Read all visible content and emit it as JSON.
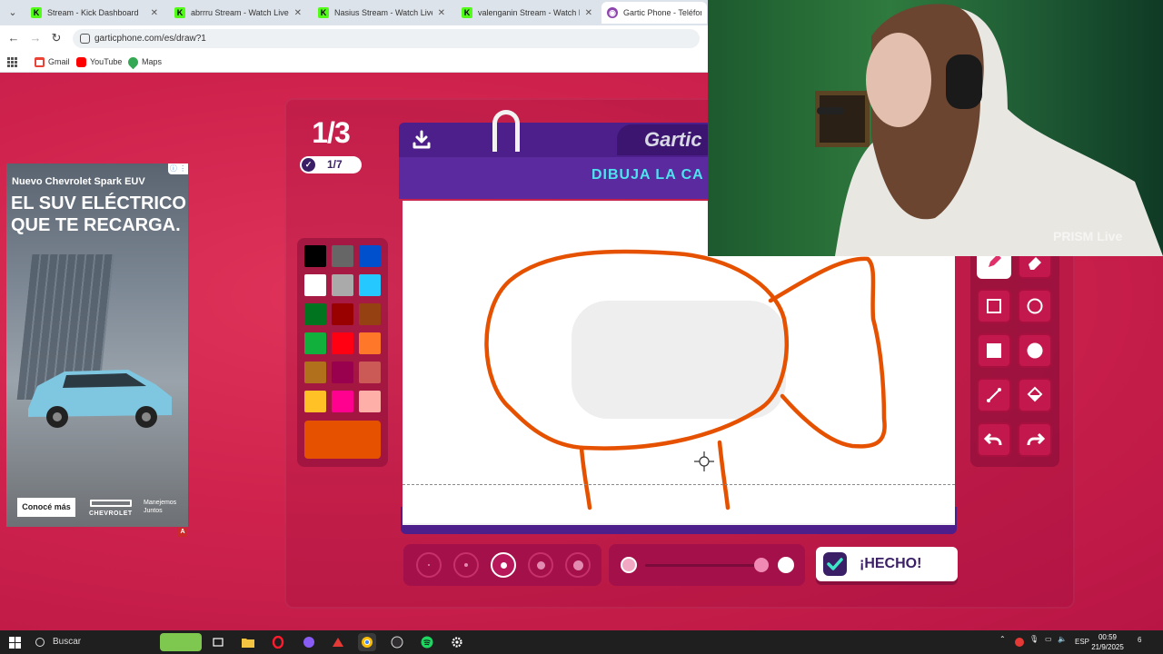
{
  "browser": {
    "tabs": [
      {
        "label": "Stream - Kick Dashboard",
        "favicon": "kick-icon",
        "active": false
      },
      {
        "label": "abrrru Stream - Watch Live on Kick",
        "favicon": "kick-icon",
        "active": false
      },
      {
        "label": "Nasius Stream - Watch Live on Kick",
        "favicon": "kick-icon",
        "active": false
      },
      {
        "label": "valenganin Stream - Watch Live",
        "favicon": "kick-icon",
        "active": false
      },
      {
        "label": "Gartic Phone - Teléfono De",
        "favicon": "gartic-icon",
        "active": true
      }
    ],
    "close_glyph": "✕",
    "url": "garticphone.com/es/draw?1",
    "bookmarks": [
      {
        "label": "Gmail",
        "icon": "gmail-icon",
        "color": "#ea4335"
      },
      {
        "label": "YouTube",
        "icon": "youtube-icon",
        "color": "#ff0000"
      },
      {
        "label": "Maps",
        "icon": "maps-icon",
        "color": "#34a853"
      }
    ]
  },
  "game": {
    "round": "1/3",
    "players_done": "1/7",
    "logo_text": "Gartic",
    "instruction": "DIBUJA LA CA",
    "done_label": "¡HECHO!",
    "palette": [
      "#000000",
      "#666666",
      "#0050cd",
      "#ffffff",
      "#aaaaaa",
      "#26c9ff",
      "#017420",
      "#990000",
      "#964112",
      "#11b03c",
      "#ff0013",
      "#ff7829",
      "#b0701c",
      "#99004e",
      "#cb5a57",
      "#ffc126",
      "#ff008f",
      "#feafa8"
    ],
    "current_color": "#e65100",
    "stroke_color": "#e65100",
    "sizes": [
      {
        "name": "size-1",
        "active": false
      },
      {
        "name": "size-2",
        "active": false
      },
      {
        "name": "size-3",
        "active": true
      },
      {
        "name": "size-4",
        "active": false
      },
      {
        "name": "size-5",
        "active": false
      }
    ],
    "tools": [
      {
        "name": "pen-tool",
        "active": true
      },
      {
        "name": "eraser-tool",
        "active": false
      },
      {
        "name": "rectangle-outline-tool",
        "active": false
      },
      {
        "name": "ellipse-outline-tool",
        "active": false
      },
      {
        "name": "rectangle-fill-tool",
        "active": false
      },
      {
        "name": "ellipse-fill-tool",
        "active": false
      },
      {
        "name": "line-tool",
        "active": false
      },
      {
        "name": "fill-bucket-tool",
        "active": false
      },
      {
        "name": "undo-tool",
        "active": false
      },
      {
        "name": "redo-tool",
        "active": false
      }
    ]
  },
  "ad": {
    "subtitle": "Nuevo Chevrolet Spark EUV",
    "headline": "EL SUV ELÉCTRICO QUE TE RECARGA.",
    "cta": "Conocé más",
    "brand": "CHEVROLET",
    "tagline": "Manejemos Juntos",
    "choice_mark": "A"
  },
  "webcam": {
    "watermark": "PRISM Live"
  },
  "taskbar": {
    "search_placeholder": "Buscar",
    "language": "ESP",
    "time": "00:59",
    "date": "21/9/2025",
    "notifications": "6"
  }
}
